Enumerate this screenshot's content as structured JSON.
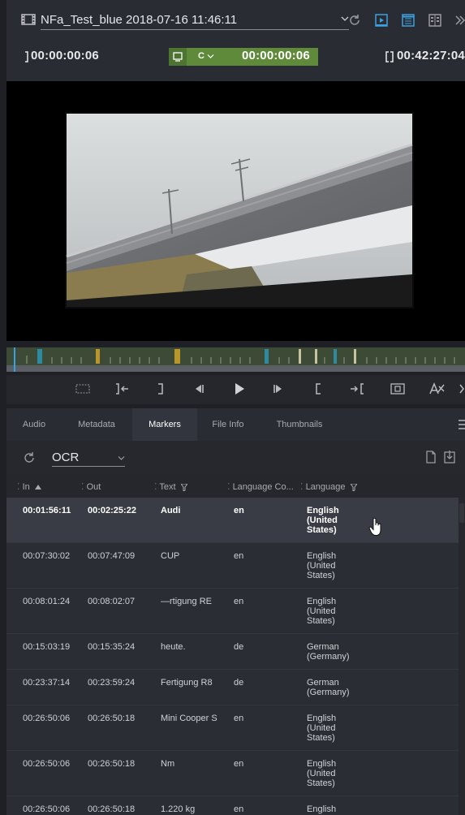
{
  "header": {
    "clip_title": "NFa_Test_blue 2018-07-16 11:46:11",
    "icons": [
      "film-icon",
      "dropdown-chevron-icon",
      "refresh-icon",
      "player-view-icon",
      "document-view-icon",
      "split-view-icon",
      "collapse-icon"
    ]
  },
  "timecode": {
    "in_point": "00:00:00:06",
    "channel": "C",
    "current": "00:00:00:06",
    "duration": "00:42:27:04"
  },
  "transport": {
    "icons": [
      "safe-area-icon",
      "go-to-in-icon",
      "mark-out-icon",
      "step-back-icon",
      "play-icon",
      "step-forward-icon",
      "mark-in-icon",
      "go-to-out-icon",
      "fullscreen-icon",
      "text-overlay-icon",
      "more-icon"
    ]
  },
  "tabs": [
    {
      "label": "Audio"
    },
    {
      "label": "Metadata"
    },
    {
      "label": "Markers"
    },
    {
      "label": "File Info"
    },
    {
      "label": "Thumbnails"
    }
  ],
  "markers": {
    "type_selected": "OCR"
  },
  "table": {
    "columns": [
      {
        "label": "In"
      },
      {
        "label": "Out"
      },
      {
        "label": "Text"
      },
      {
        "label": "Language Co..."
      },
      {
        "label": "Language"
      }
    ],
    "rows": [
      {
        "in": "00:01:56:11",
        "out": "00:02:25:22",
        "text": "Audi",
        "code": "en",
        "language": "English (United States)",
        "selected": true
      },
      {
        "in": "00:07:30:02",
        "out": "00:07:47:09",
        "text": "CUP",
        "code": "en",
        "language": "English (United States)"
      },
      {
        "in": "00:08:01:24",
        "out": "00:08:02:07",
        "text": "—rtigung RE",
        "code": "en",
        "language": "English (United States)"
      },
      {
        "in": "00:15:03:19",
        "out": "00:15:35:24",
        "text": "heute.",
        "code": "de",
        "language": "German (Germany)"
      },
      {
        "in": "00:23:37:14",
        "out": "00:23:59:24",
        "text": "Fertigung R8",
        "code": "de",
        "language": "German (Germany)"
      },
      {
        "in": "00:26:50:06",
        "out": "00:26:50:18",
        "text": "Mini Cooper S",
        "code": "en",
        "language": "English (United States)"
      },
      {
        "in": "00:26:50:06",
        "out": "00:26:50:18",
        "text": "Nm",
        "code": "en",
        "language": "English (United States)"
      },
      {
        "in": "00:26:50:06",
        "out": "00:26:50:18",
        "text": "1.220 kg",
        "code": "en",
        "language": "English"
      }
    ]
  },
  "colors": {
    "accent_blue": "#3aa0e0",
    "timecode_green": "#5e8a3a",
    "timeline_markers": [
      "#b8962a",
      "#2e8a9e",
      "#c8c2a0"
    ]
  }
}
